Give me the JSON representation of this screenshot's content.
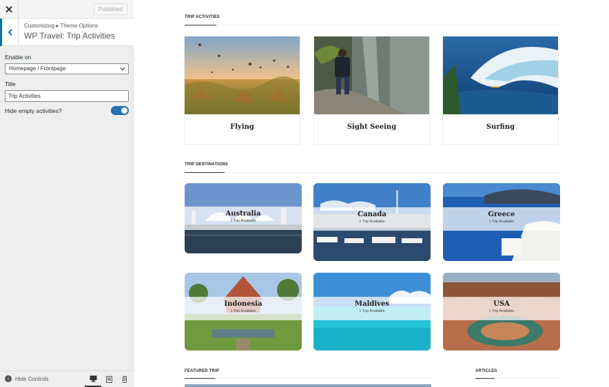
{
  "customizer": {
    "close_icon": "close-icon",
    "published_label": "Published",
    "breadcrumb": "Customizing ▸ Theme Options",
    "section_title": "WP Travel: Trip Activities",
    "enable_on_label": "Enable on",
    "enable_on_value": "Homepage / Frontpage",
    "title_label": "Title",
    "title_value": "Trip Activities",
    "hide_empty_label": "Hide empty activities?",
    "hide_empty_on": true,
    "hide_controls_label": "Hide Controls",
    "accent": "#2271b1"
  },
  "preview": {
    "activities_heading": "TRIP ACTIVITIES",
    "activities": [
      {
        "label": "Flying"
      },
      {
        "label": "Sight Seeing"
      },
      {
        "label": "Surfing"
      }
    ],
    "destinations_heading": "TRIP DESTINATIONS",
    "destinations": [
      {
        "name": "Australia",
        "sub": "1 Trip Available"
      },
      {
        "name": "Canada",
        "sub": "1 Trip Available"
      },
      {
        "name": "Greece",
        "sub": "1 Trip Available"
      },
      {
        "name": "Indonesia",
        "sub": "1 Trip Available"
      },
      {
        "name": "Maldives",
        "sub": "1 Trip Available"
      },
      {
        "name": "USA",
        "sub": "1 Trip Available"
      }
    ],
    "featured_heading": "FEATURED TRIP",
    "articles_heading": "ARTICLES"
  }
}
